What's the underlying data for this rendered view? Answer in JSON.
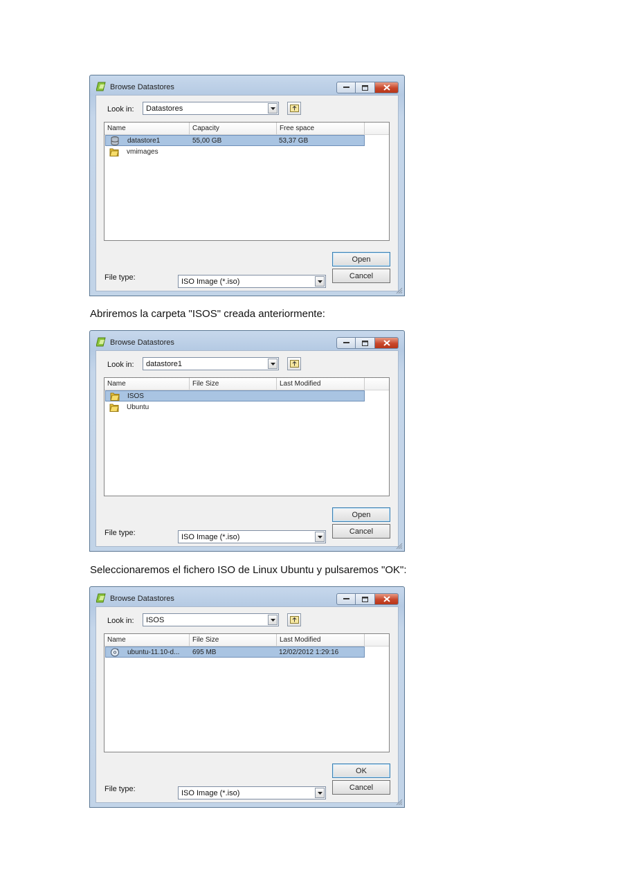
{
  "captions": [
    "Abriremos la carpeta \"ISOS\" creada anteriormente:",
    "Seleccionaremos el fichero ISO de Linux Ubuntu y pulsaremos \"OK\":"
  ],
  "dialogs": [
    {
      "title": "Browse Datastores",
      "look_in_label": "Look in:",
      "look_in_value": "Datastores",
      "columns": [
        "Name",
        "Capacity",
        "Free space"
      ],
      "rows": [
        {
          "icon": "database-icon",
          "name": "datastore1",
          "col2": "55,00 GB",
          "col3": "53,37 GB",
          "selected": true
        },
        {
          "icon": "folder-icon",
          "name": "vmimages",
          "col2": "",
          "col3": "",
          "selected": false
        }
      ],
      "file_type_label": "File type:",
      "file_type_value": "ISO Image (*.iso)",
      "primary_button": "Open",
      "cancel_button": "Cancel"
    },
    {
      "title": "Browse Datastores",
      "look_in_label": "Look in:",
      "look_in_value": "datastore1",
      "columns": [
        "Name",
        "File Size",
        "Last Modified"
      ],
      "rows": [
        {
          "icon": "folder-icon",
          "name": "ISOS",
          "col2": "",
          "col3": "",
          "selected": true
        },
        {
          "icon": "folder-icon",
          "name": "Ubuntu",
          "col2": "",
          "col3": "",
          "selected": false
        }
      ],
      "file_type_label": "File type:",
      "file_type_value": "ISO Image (*.iso)",
      "primary_button": "Open",
      "cancel_button": "Cancel"
    },
    {
      "title": "Browse Datastores",
      "look_in_label": "Look in:",
      "look_in_value": "ISOS",
      "columns": [
        "Name",
        "File Size",
        "Last Modified"
      ],
      "rows": [
        {
          "icon": "disc-icon",
          "name": "ubuntu-11.10-d...",
          "col2": "695 MB",
          "col3": "12/02/2012 1:29:16",
          "selected": true
        }
      ],
      "file_type_label": "File type:",
      "file_type_value": "ISO Image (*.iso)",
      "primary_button": "OK",
      "cancel_button": "Cancel"
    }
  ]
}
